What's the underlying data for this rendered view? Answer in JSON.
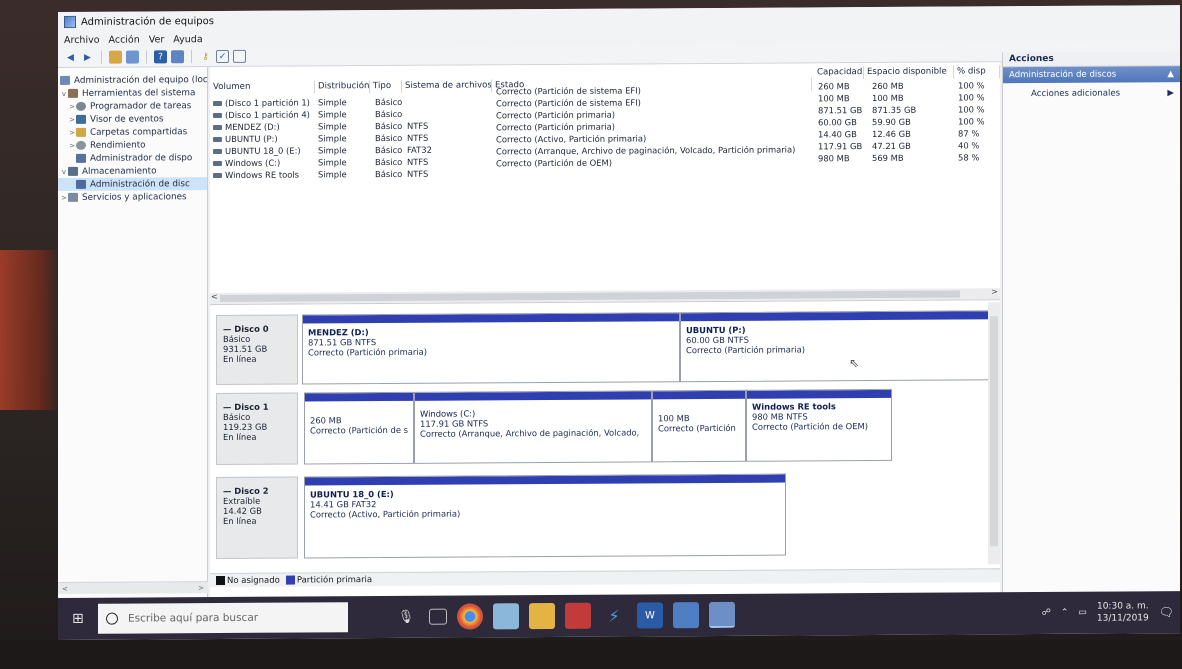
{
  "window": {
    "title": "Administración de equipos"
  },
  "menu": [
    "Archivo",
    "Acción",
    "Ver",
    "Ayuda"
  ],
  "tree": [
    {
      "label": "Administración del equipo (loc",
      "level": 0,
      "twisty": ""
    },
    {
      "label": "Herramientas del sistema",
      "level": 0,
      "twisty": "v"
    },
    {
      "label": "Programador de tareas",
      "level": 1,
      "twisty": ">"
    },
    {
      "label": "Visor de eventos",
      "level": 1,
      "twisty": ">"
    },
    {
      "label": "Carpetas compartidas",
      "level": 1,
      "twisty": ">"
    },
    {
      "label": "Rendimiento",
      "level": 1,
      "twisty": ">"
    },
    {
      "label": "Administrador de dispo",
      "level": 1,
      "twisty": ""
    },
    {
      "label": "Almacenamiento",
      "level": 0,
      "twisty": "v"
    },
    {
      "label": "Administración de disc",
      "level": 1,
      "twisty": ""
    },
    {
      "label": "Servicios y aplicaciones",
      "level": 0,
      "twisty": ">"
    }
  ],
  "columns": {
    "volumen": "Volumen",
    "distribucion": "Distribución",
    "tipo": "Tipo",
    "sistema": "Sistema de archivos",
    "estado": "Estado",
    "capacidad": "Capacidad",
    "espacio": "Espacio disponible",
    "pct": "% disp"
  },
  "volumes": [
    {
      "volumen": "(Disco 1 partición 1)",
      "distribucion": "Simple",
      "tipo": "Básico",
      "sistema": ""
    },
    {
      "volumen": "(Disco 1 partición 4)",
      "distribucion": "Simple",
      "tipo": "Básico",
      "sistema": ""
    },
    {
      "volumen": "MENDEZ (D:)",
      "distribucion": "Simple",
      "tipo": "Básico",
      "sistema": "NTFS"
    },
    {
      "volumen": "UBUNTU (P:)",
      "distribucion": "Simple",
      "tipo": "Básico",
      "sistema": "NTFS"
    },
    {
      "volumen": "UBUNTU 18_0 (E:)",
      "distribucion": "Simple",
      "tipo": "Básico",
      "sistema": "FAT32"
    },
    {
      "volumen": "Windows (C:)",
      "distribucion": "Simple",
      "tipo": "Básico",
      "sistema": "NTFS"
    },
    {
      "volumen": "Windows RE tools",
      "distribucion": "Simple",
      "tipo": "Básico",
      "sistema": "NTFS"
    }
  ],
  "states": [
    "Correcto (Partición de sistema EFI)",
    "Correcto (Partición de sistema EFI)",
    "Correcto (Partición primaria)",
    "Correcto (Partición primaria)",
    "Correcto (Activo, Partición primaria)",
    "Correcto (Arranque, Archivo de paginación, Volcado, Partición primaria)",
    "Correcto (Partición de OEM)"
  ],
  "capacities": [
    {
      "capacidad": "260 MB",
      "espacio": "260 MB",
      "pct": "100 %"
    },
    {
      "capacidad": "100 MB",
      "espacio": "100 MB",
      "pct": "100 %"
    },
    {
      "capacidad": "871.51 GB",
      "espacio": "871.35 GB",
      "pct": "100 %"
    },
    {
      "capacidad": "60.00 GB",
      "espacio": "59.90 GB",
      "pct": "100 %"
    },
    {
      "capacidad": "14.40 GB",
      "espacio": "12.46 GB",
      "pct": "87 %"
    },
    {
      "capacidad": "117.91 GB",
      "espacio": "47.21 GB",
      "pct": "40 %"
    },
    {
      "capacidad": "980 MB",
      "espacio": "569 MB",
      "pct": "58 %"
    }
  ],
  "disks": [
    {
      "name": "Disco 0",
      "kind": "Básico",
      "size": "931.51 GB",
      "status": "En línea",
      "partitions": [
        {
          "name": "MENDEZ (D:)",
          "size": "871.51 GB NTFS",
          "state": "Correcto (Partición primaria)"
        },
        {
          "name": "UBUNTU (P:)",
          "size": "60.00 GB NTFS",
          "state": "Correcto (Partición primaria)"
        }
      ]
    },
    {
      "name": "Disco 1",
      "kind": "Básico",
      "size": "119.23 GB",
      "status": "En línea",
      "partitions": [
        {
          "name": "",
          "size": "260 MB",
          "state": "Correcto (Partición de s"
        },
        {
          "name": "Windows (C:)",
          "size": "117.91 GB NTFS",
          "state": "Correcto (Arranque, Archivo de paginación, Volcado,"
        },
        {
          "name": "",
          "size": "100 MB",
          "state": "Correcto (Partición"
        },
        {
          "name": "Windows RE tools",
          "size": "980 MB NTFS",
          "state": "Correcto (Partición de OEM)"
        }
      ]
    },
    {
      "name": "Disco 2",
      "kind": "Extraíble",
      "size": "14.42 GB",
      "status": "En línea",
      "partitions": [
        {
          "name": "UBUNTU 18_0 (E:)",
          "size": "14.41 GB FAT32",
          "state": "Correcto (Activo, Partición primaria)"
        }
      ]
    }
  ],
  "legend": {
    "unallocated": "No asignado",
    "primary": "Partición primaria"
  },
  "actions": {
    "header": "Acciones",
    "section": "Administración de discos",
    "more": "Acciones adicionales"
  },
  "taskbar": {
    "search_placeholder": "Escribe aquí para buscar",
    "time": "10:30 a. m.",
    "date": "13/11/2019"
  },
  "colors": {
    "primary_partition": "#2f3fb1",
    "unallocated": "#111111",
    "taskbar": "#2e2a3c"
  }
}
